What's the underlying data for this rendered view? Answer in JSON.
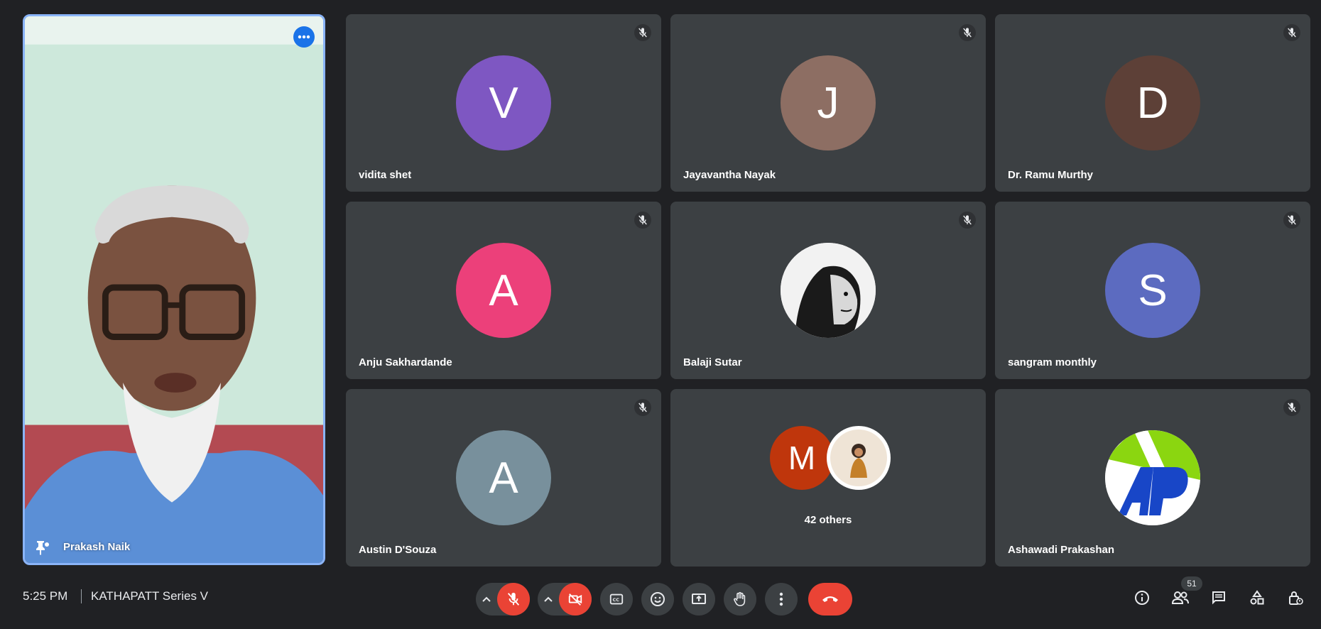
{
  "speaker": {
    "name": "Prakash Naik"
  },
  "tiles": [
    {
      "name": "vidita shet",
      "initial": "V",
      "color": "#7e57c2"
    },
    {
      "name": "Jayavantha Nayak",
      "initial": "J",
      "color": "#8d6e63"
    },
    {
      "name": "Dr. Ramu Murthy",
      "initial": "D",
      "color": "#5d4037"
    },
    {
      "name": "Anju Sakhardande",
      "initial": "A",
      "color": "#ec407a"
    },
    {
      "name": "Balaji Sutar",
      "initial": "",
      "color": "#ffffff"
    },
    {
      "name": "sangram monthly",
      "initial": "S",
      "color": "#5c6bc0"
    },
    {
      "name": "Austin D'Souza",
      "initial": "A",
      "color": "#78909c"
    },
    {
      "name": "",
      "initial": "",
      "color": "#3c4043"
    },
    {
      "name": "Ashawadi Prakashan",
      "initial": "",
      "color": "#ffffff"
    }
  ],
  "others": {
    "initial": "M",
    "color": "#bf360c",
    "label": "42 others"
  },
  "bottom_bar": {
    "time": "5:25 PM",
    "meeting_title": "KATHAPATT Series V",
    "participant_count": "51"
  },
  "icons": {
    "mute": "mic-off-icon",
    "camera": "camera-off-icon",
    "captions": "captions-icon",
    "emoji": "emoji-icon",
    "present": "present-screen-icon",
    "hand": "raise-hand-icon",
    "more": "more-options-icon",
    "leave": "end-call-icon",
    "info": "info-icon",
    "people": "people-icon",
    "chat": "chat-icon",
    "activities": "activities-icon",
    "host": "host-controls-icon"
  }
}
